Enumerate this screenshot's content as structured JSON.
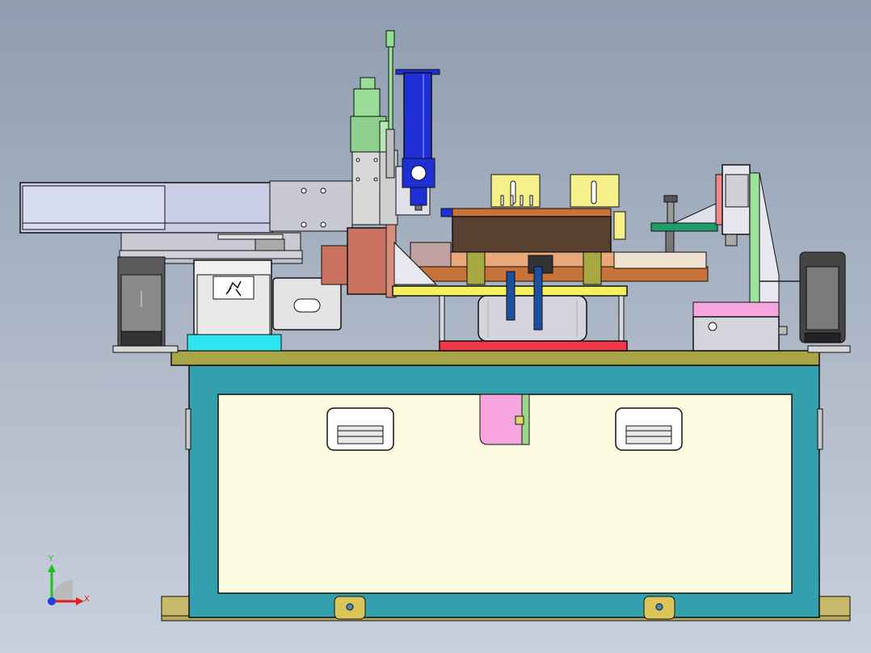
{
  "viewport": {
    "background_top": "#8f9db0",
    "background_bottom": "#c9d0dc"
  },
  "colors": {
    "cabinet_frame": "#34a0ad",
    "cabinet_panel": "#fdfbe0",
    "tabletop": "#a8a548",
    "rail": "#c9cee6",
    "servo_green": "#99dd99",
    "syringe_blue": "#1e2fd6",
    "tray_brown": "#5a4030",
    "tray_copper": "#c8733a",
    "yellow_plate": "#f4ef5c",
    "red_base": "#f2384a",
    "pink_block": "#f7a5de",
    "cyan_base": "#2ee6f0",
    "wheel": "#555555",
    "motor_copper": "#c97260",
    "cylinder_blue": "#1d4fa0"
  },
  "axis_triad": {
    "x_label": "X",
    "y_label": "Y",
    "x_color": "#e02020",
    "y_color": "#20c020",
    "z_color": "#2040e0"
  },
  "icons": {
    "logo": "running-figure-logo-icon",
    "handles": "drawer-handle-icon",
    "triad": "coordinate-triad-icon"
  }
}
